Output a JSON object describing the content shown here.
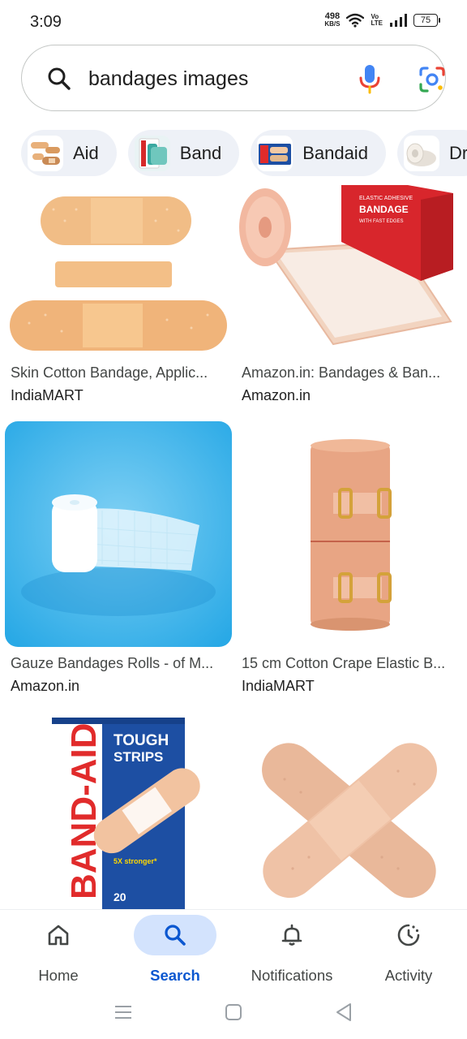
{
  "status_bar": {
    "time": "3:09",
    "net_speed_value": "498",
    "net_speed_unit": "KB/S",
    "volte_line1": "Vo",
    "volte_line2": "LTE",
    "battery": "75"
  },
  "search": {
    "query": "bandages images"
  },
  "chips": [
    {
      "label": "Aid"
    },
    {
      "label": "Band"
    },
    {
      "label": "Bandaid"
    },
    {
      "label": "Dr"
    }
  ],
  "results": [
    {
      "title": "Skin Cotton Bandage, Applic...",
      "source": "IndiaMART"
    },
    {
      "title": "Amazon.in: Bandages & Ban...",
      "source": "Amazon.in"
    },
    {
      "title": "Gauze Bandages Rolls - of M...",
      "source": "Amazon.in"
    },
    {
      "title": "15 cm Cotton Crape Elastic B...",
      "source": "IndiaMART"
    },
    {
      "title": "",
      "source": ""
    },
    {
      "title": "",
      "source": ""
    }
  ],
  "image_text": {
    "elastic_box_line1": "ELASTIC ADHESIVE",
    "elastic_box_line2": "BANDAGE",
    "elastic_box_line3": "WITH FAST EDGES",
    "bandaid_brand": "BAND-AID",
    "bandaid_tough": "TOUGH",
    "bandaid_strips": "STRIPS",
    "bandaid_stronger": "5X stronger*",
    "bandaid_count": "20"
  },
  "bottom_nav": {
    "home": "Home",
    "search": "Search",
    "notifications": "Notifications",
    "activity": "Activity",
    "active": "search"
  },
  "colors": {
    "accent": "#0b57d0",
    "active_pill": "#d3e3fd",
    "chip_bg": "#eef1f7"
  }
}
